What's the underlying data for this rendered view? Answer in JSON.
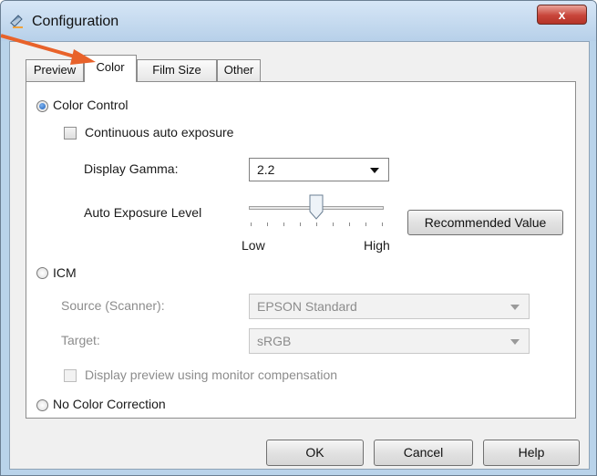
{
  "window": {
    "title": "Configuration",
    "close_label": "x"
  },
  "tabs": [
    {
      "label": "Preview",
      "active": false
    },
    {
      "label": "Color",
      "active": true
    },
    {
      "label": "Film Size",
      "active": false
    },
    {
      "label": "Other",
      "active": false
    }
  ],
  "color_control": {
    "label": "Color Control",
    "selected": true,
    "continuous_auto_exposure": {
      "label": "Continuous auto exposure",
      "checked": false
    },
    "display_gamma": {
      "label": "Display Gamma:",
      "value": "2.2"
    },
    "auto_exposure": {
      "label": "Auto Exposure Level",
      "level": 0.5,
      "low_label": "Low",
      "high_label": "High",
      "recommended_label": "Recommended Value"
    }
  },
  "icm": {
    "label": "ICM",
    "selected": false,
    "source": {
      "label": "Source (Scanner):",
      "value": "EPSON Standard"
    },
    "target": {
      "label": "Target:",
      "value": "sRGB"
    },
    "display_preview": {
      "label": "Display preview using monitor compensation",
      "checked": false
    }
  },
  "no_color_correction": {
    "label": "No Color Correction",
    "selected": false
  },
  "buttons": {
    "ok": "OK",
    "cancel": "Cancel",
    "help": "Help"
  },
  "annotation_arrow": {
    "color": "#e8622a",
    "points_to": "tab-color"
  }
}
